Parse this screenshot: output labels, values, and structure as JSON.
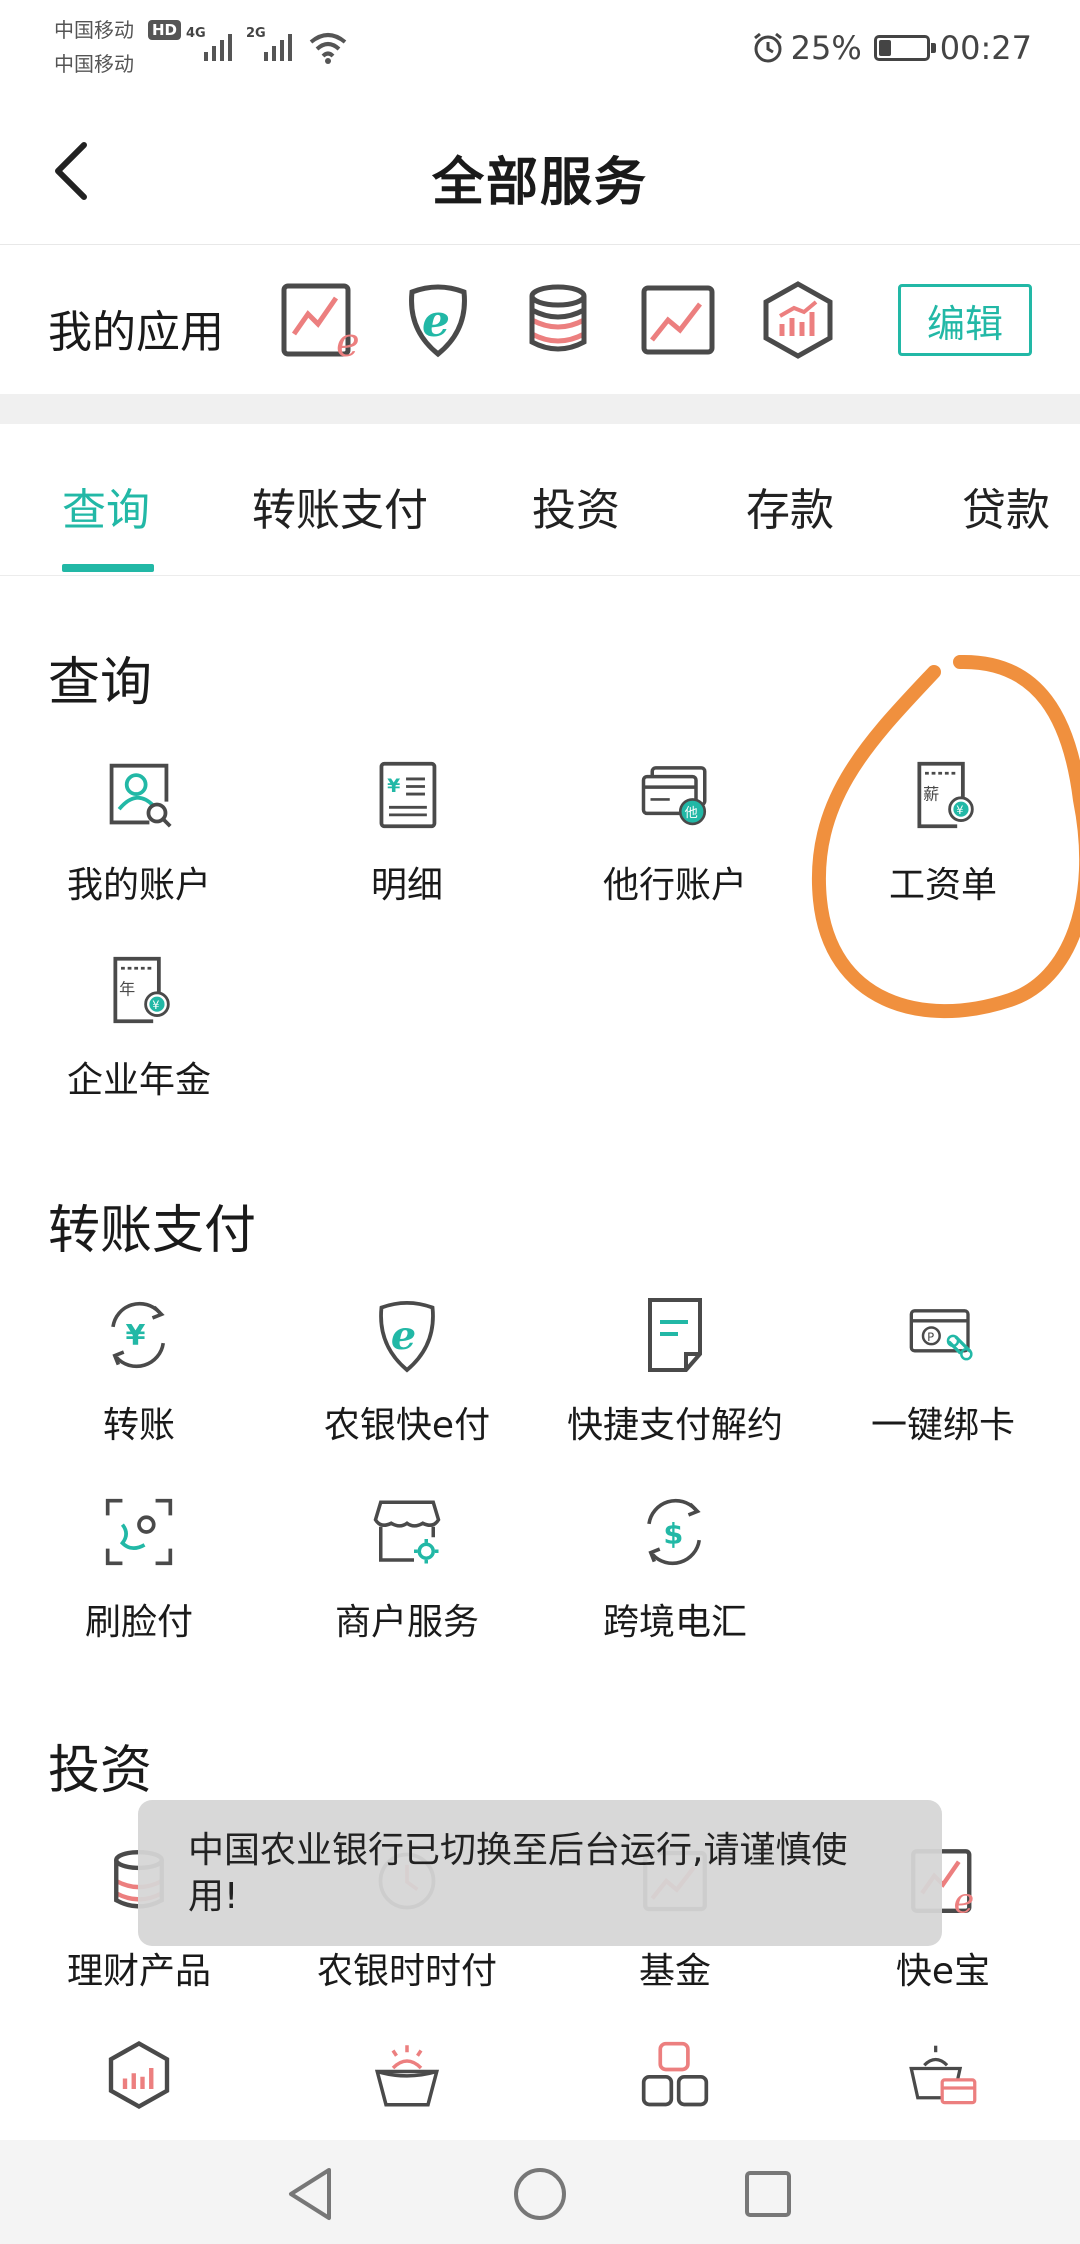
{
  "status_bar": {
    "carrier1": "中国移动",
    "carrier2": "中国移动",
    "hd": "HD",
    "net1": "4G",
    "net2": "2G",
    "battery_percent_text": "25%",
    "battery_level": 0.25,
    "time": "00:27",
    "icons": [
      "signal-icon",
      "wifi-icon",
      "alarm-icon",
      "battery-icon"
    ]
  },
  "header": {
    "title": "全部服务",
    "back_icon": "back-arrow-icon"
  },
  "my_apps": {
    "label": "我的应用",
    "edit_label": "编辑",
    "icons": [
      "kuai-e-bao-icon",
      "nongyin-kuai-e-fu-icon",
      "licai-coins-icon",
      "fund-chart-icon",
      "investment-hexagon-icon"
    ]
  },
  "tabs": [
    {
      "label": "查询",
      "active": true
    },
    {
      "label": "转账支付",
      "active": false
    },
    {
      "label": "投资",
      "active": false
    },
    {
      "label": "存款",
      "active": false
    },
    {
      "label": "贷款",
      "active": false
    }
  ],
  "sections": {
    "query": {
      "title": "查询",
      "items": [
        {
          "label": "我的账户",
          "icon": "account-search-icon"
        },
        {
          "label": "明细",
          "icon": "statement-icon"
        },
        {
          "label": "他行账户",
          "icon": "other-bank-card-icon",
          "icon_text": "他"
        },
        {
          "label": "工资单",
          "icon": "payslip-icon",
          "icon_text": "薪"
        },
        {
          "label": "企业年金",
          "icon": "annuity-icon",
          "icon_text": "年"
        }
      ]
    },
    "transfer": {
      "title": "转账支付",
      "items": [
        {
          "label": "转账",
          "icon": "transfer-yuan-icon"
        },
        {
          "label": "农银快e付",
          "icon": "e-pay-shield-icon"
        },
        {
          "label": "快捷支付解约",
          "icon": "document-icon"
        },
        {
          "label": "一键绑卡",
          "icon": "bind-card-icon"
        },
        {
          "label": "刷脸付",
          "icon": "face-pay-icon"
        },
        {
          "label": "商户服务",
          "icon": "merchant-store-icon"
        },
        {
          "label": "跨境电汇",
          "icon": "cross-border-dollar-icon"
        }
      ]
    },
    "invest": {
      "title": "投资",
      "items": [
        {
          "label": "理财产品",
          "icon": "licai-coins-icon"
        },
        {
          "label": "农银时时付",
          "icon": "shishifu-icon"
        },
        {
          "label": "基金",
          "icon": "fund-chart-icon"
        },
        {
          "label": "快e宝",
          "icon": "kuai-e-bao-icon"
        }
      ],
      "row2_icons": [
        "investment-hexagon-icon",
        "basket-sun-icon",
        "blocks-icon",
        "basket-card-icon"
      ]
    }
  },
  "toast": {
    "text": "中国农业银行已切换至后台运行,请谨慎使用!"
  },
  "colors": {
    "accent": "#22b8a6",
    "pink": "#ec7f7f",
    "icon_gray": "#4a4a4a",
    "annotation": "#f0903e"
  },
  "navbar": {
    "icons": [
      "nav-back-icon",
      "nav-home-icon",
      "nav-recent-icon"
    ]
  }
}
